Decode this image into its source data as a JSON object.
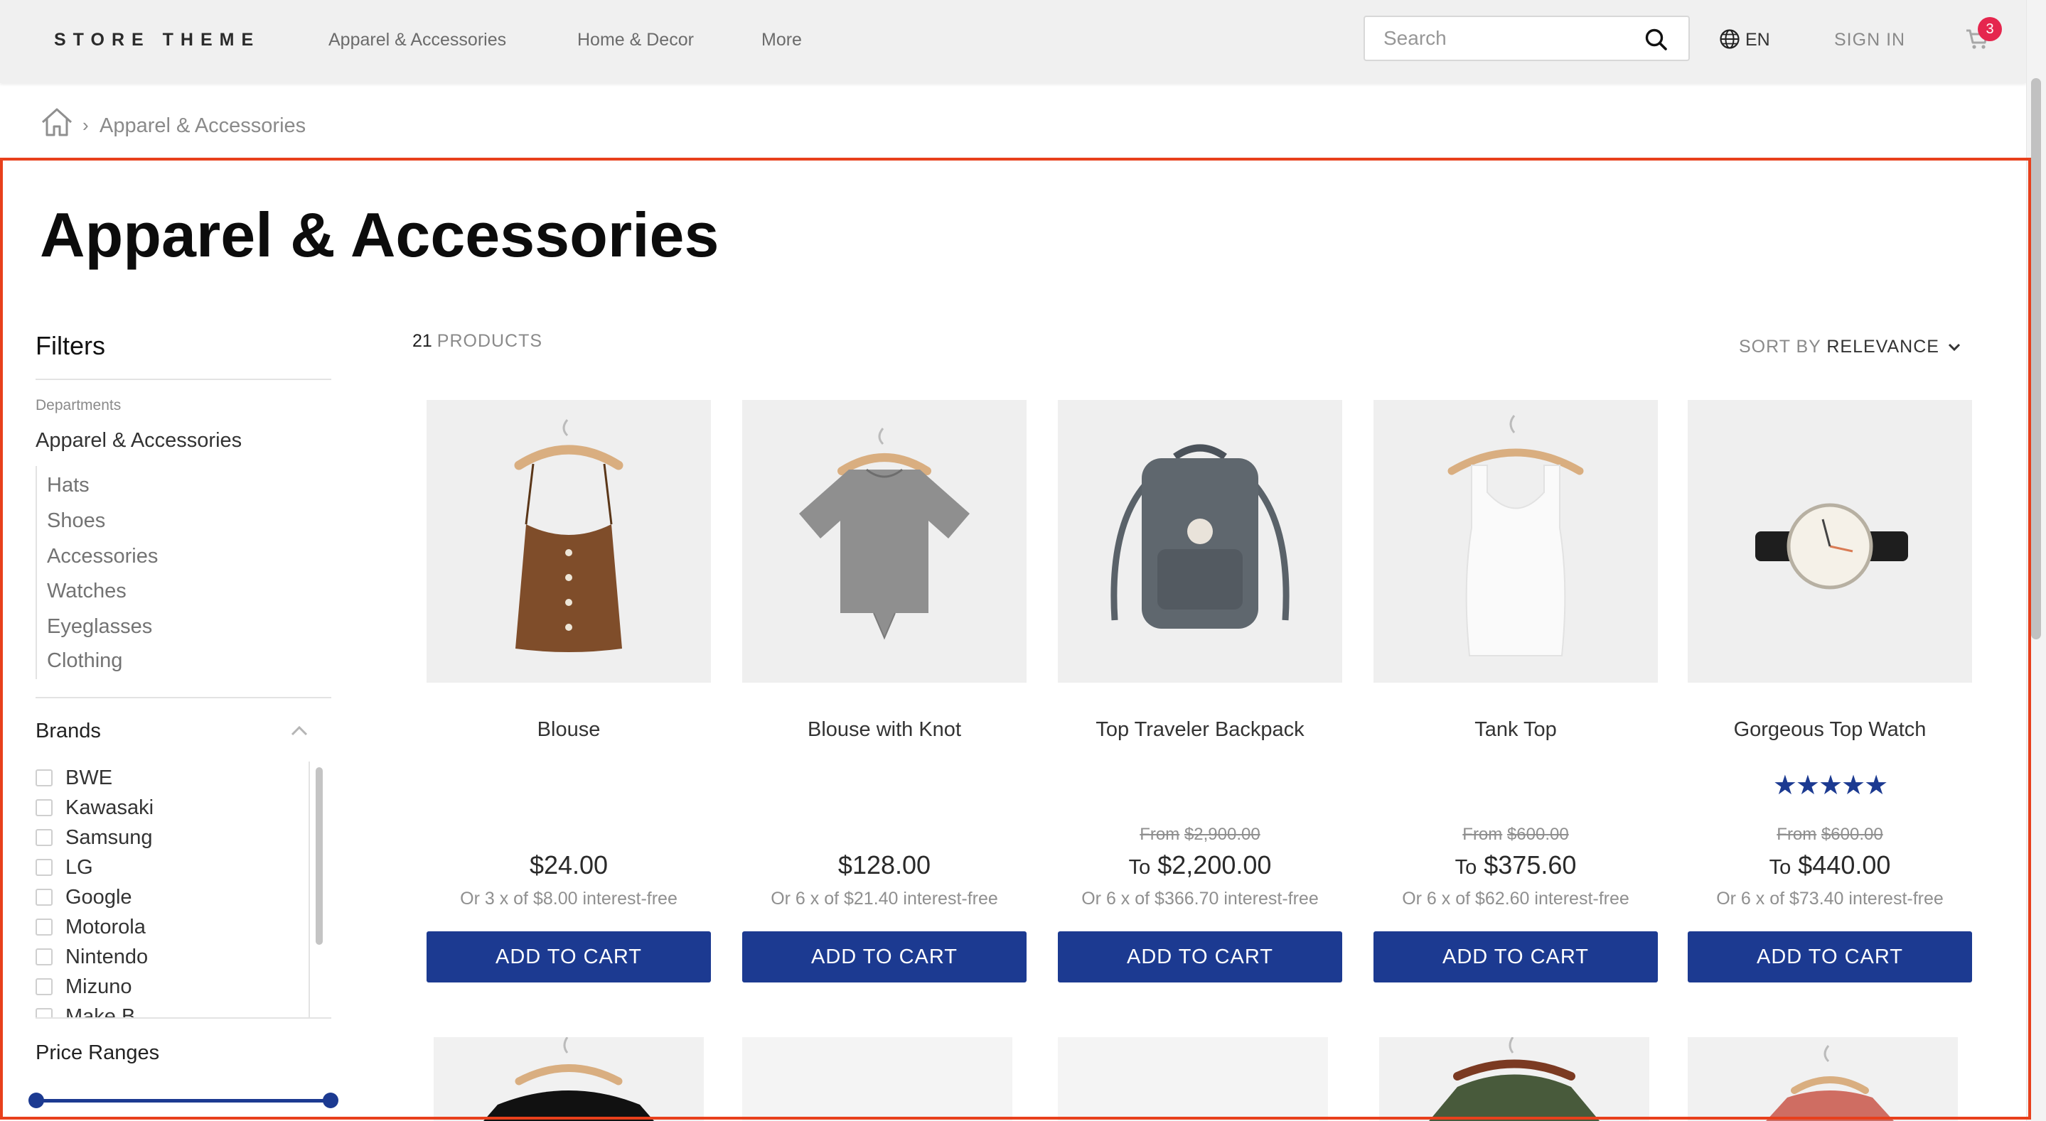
{
  "header": {
    "logo": "STORE THEME",
    "nav": [
      "Apparel & Accessories",
      "Home & Decor",
      "More"
    ],
    "search_placeholder": "Search",
    "language": "EN",
    "sign_in": "SIGN IN",
    "cart_count": "3",
    "icons": {
      "search": "search-icon",
      "language": "globe-icon",
      "cart": "cart-icon"
    }
  },
  "breadcrumb": {
    "separator": "›",
    "current": "Apparel & Accessories",
    "icon": "home-icon"
  },
  "page_title": "Apparel & Accessories",
  "filters": {
    "title": "Filters",
    "departments_label": "Departments",
    "department_current": "Apparel & Accessories",
    "departments": [
      "Hats",
      "Shoes",
      "Accessories",
      "Watches",
      "Eyeglasses",
      "Clothing"
    ],
    "brands_title": "Brands",
    "brands": [
      "BWE",
      "Kawasaki",
      "Samsung",
      "LG",
      "Google",
      "Motorola",
      "Nintendo",
      "Mizuno",
      "Make B"
    ],
    "price_title": "Price Ranges"
  },
  "results": {
    "count": "21",
    "count_label": "PRODUCTS",
    "sort_prefix": "SORT BY",
    "sort_value": "RELEVANCE"
  },
  "products": [
    {
      "name": "Blouse",
      "list_from": "",
      "list_price": "",
      "to": "",
      "price": "$24.00",
      "installments": "Or 3 x of $8.00 interest-free",
      "button": "ADD TO CART",
      "rating": null
    },
    {
      "name": "Blouse with Knot",
      "list_from": "",
      "list_price": "",
      "to": "",
      "price": "$128.00",
      "installments": "Or 6 x of $21.40 interest-free",
      "button": "ADD TO CART",
      "rating": null
    },
    {
      "name": "Top Traveler Backpack",
      "list_from": "From",
      "list_price": "$2,900.00",
      "to": "To",
      "price": "$2,200.00",
      "installments": "Or 6 x of $366.70 interest-free",
      "button": "ADD TO CART",
      "rating": null
    },
    {
      "name": "Tank Top",
      "list_from": "From",
      "list_price": "$600.00",
      "to": "To",
      "price": "$375.60",
      "installments": "Or 6 x of $62.60 interest-free",
      "button": "ADD TO CART",
      "rating": null
    },
    {
      "name": "Gorgeous Top Watch",
      "list_from": "From",
      "list_price": "$600.00",
      "to": "To",
      "price": "$440.00",
      "installments": "Or 6 x of $73.40 interest-free",
      "button": "ADD TO CART",
      "rating": "★★★★★"
    }
  ],
  "colors": {
    "accent": "#1c3a91",
    "badge": "#e5264e",
    "frame": "#e8401c"
  }
}
